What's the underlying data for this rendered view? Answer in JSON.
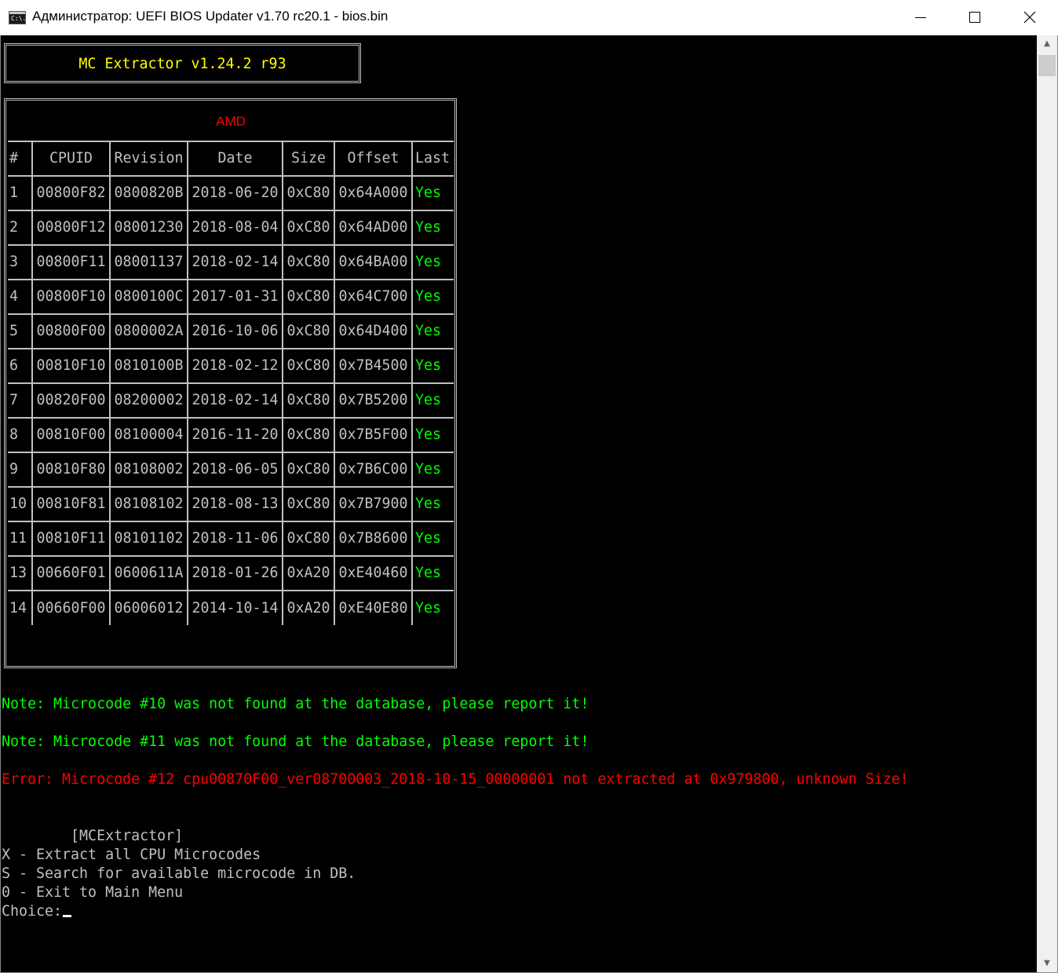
{
  "window": {
    "title": "Администратор:  UEFI BIOS Updater v1.70 rc20.1 - bios.bin",
    "icon_text": "C:\\.",
    "buttons": {
      "minimize": "minimize-icon",
      "maximize": "maximize-icon",
      "close": "close-icon"
    }
  },
  "console": {
    "header": "MC Extractor v1.24.2 r93",
    "table": {
      "title": "AMD",
      "columns": [
        "#",
        "CPUID",
        "Revision",
        "Date",
        "Size",
        "Offset",
        "Last"
      ],
      "rows": [
        [
          "1",
          "00800F82",
          "0800820B",
          "2018-06-20",
          "0xC80",
          "0x64A000",
          "Yes"
        ],
        [
          "2",
          "00800F12",
          "08001230",
          "2018-08-04",
          "0xC80",
          "0x64AD00",
          "Yes"
        ],
        [
          "3",
          "00800F11",
          "08001137",
          "2018-02-14",
          "0xC80",
          "0x64BA00",
          "Yes"
        ],
        [
          "4",
          "00800F10",
          "0800100C",
          "2017-01-31",
          "0xC80",
          "0x64C700",
          "Yes"
        ],
        [
          "5",
          "00800F00",
          "0800002A",
          "2016-10-06",
          "0xC80",
          "0x64D400",
          "Yes"
        ],
        [
          "6",
          "00810F10",
          "0810100B",
          "2018-02-12",
          "0xC80",
          "0x7B4500",
          "Yes"
        ],
        [
          "7",
          "00820F00",
          "08200002",
          "2018-02-14",
          "0xC80",
          "0x7B5200",
          "Yes"
        ],
        [
          "8",
          "00810F00",
          "08100004",
          "2016-11-20",
          "0xC80",
          "0x7B5F00",
          "Yes"
        ],
        [
          "9",
          "00810F80",
          "08108002",
          "2018-06-05",
          "0xC80",
          "0x7B6C00",
          "Yes"
        ],
        [
          "10",
          "00810F81",
          "08108102",
          "2018-08-13",
          "0xC80",
          "0x7B7900",
          "Yes"
        ],
        [
          "11",
          "00810F11",
          "08101102",
          "2018-11-06",
          "0xC80",
          "0x7B8600",
          "Yes"
        ],
        [
          "13",
          "00660F01",
          "0600611A",
          "2018-01-26",
          "0xA20",
          "0xE40460",
          "Yes"
        ],
        [
          "14",
          "00660F00",
          "06006012",
          "2014-10-14",
          "0xA20",
          "0xE40E80",
          "Yes"
        ]
      ]
    },
    "notes": [
      "Note: Microcode #10 was not found at the database, please report it!",
      "Note: Microcode #11 was not found at the database, please report it!"
    ],
    "error": "Error: Microcode #12 cpu00870F00_ver08700003_2018-10-15_00000001 not extracted at 0x979800, unknown Size!",
    "menu": {
      "title": "        [MCExtractor]",
      "items": [
        "X - Extract all CPU Microcodes",
        "S - Search for available microcode in DB.",
        "0 - Exit to Main Menu"
      ],
      "prompt": "Choice:"
    }
  },
  "colors": {
    "background": "#000000",
    "text": "#c0c0c0",
    "header": "#ffff00",
    "ok": "#00ff00",
    "error": "#ff0000"
  }
}
